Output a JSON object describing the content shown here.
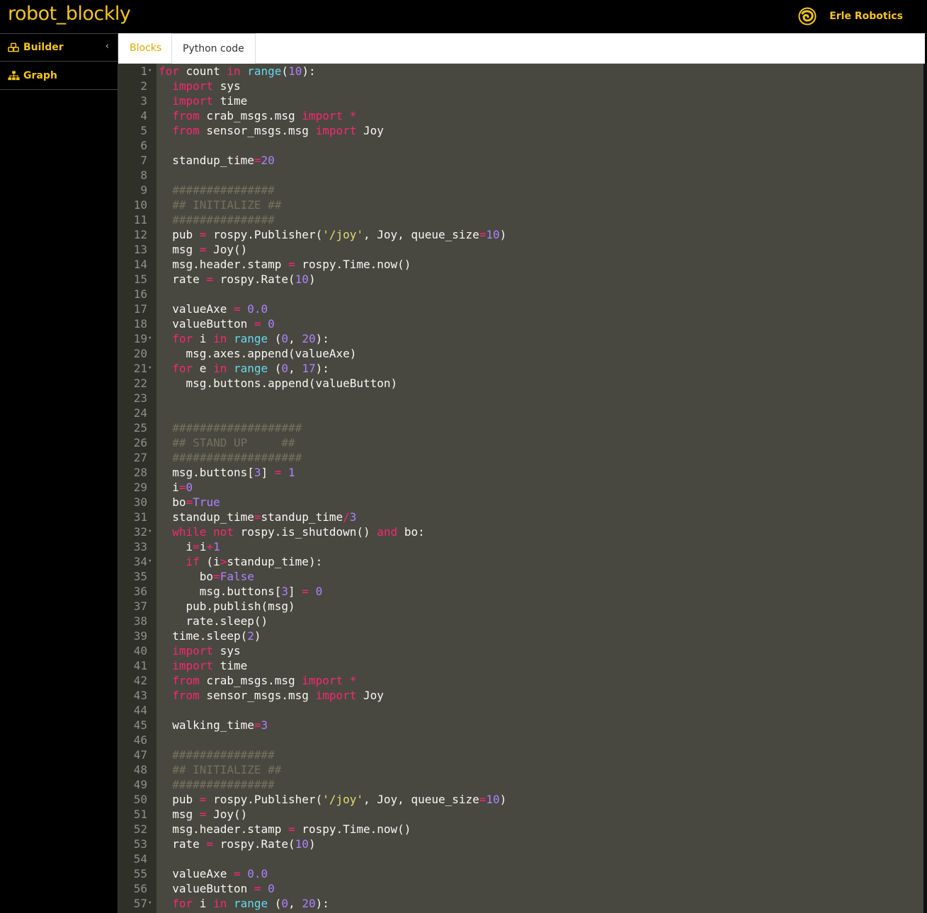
{
  "app": {
    "title": "robot_blockly",
    "brand": "Erle Robotics"
  },
  "sidebar": {
    "items": [
      {
        "label": "Builder",
        "icon": "cubes-icon",
        "collapse": "‹"
      },
      {
        "label": "Graph",
        "icon": "sitemap-icon"
      }
    ]
  },
  "tabs": [
    {
      "label": "Blocks",
      "active": false
    },
    {
      "label": "Python code",
      "active": true
    }
  ],
  "colors": {
    "accent": "#f5c518",
    "editor_bg": "#484840",
    "gutter_bg": "#2f3129",
    "keyword": "#f92672",
    "builtin": "#66d9ef",
    "number": "#ae81ff",
    "string": "#e6db74",
    "comment": "#75715e"
  },
  "code": {
    "folded_lines": [
      1,
      19,
      21,
      32,
      34,
      57
    ],
    "lines": [
      "for count in range(10):",
      "  import sys",
      "  import time",
      "  from crab_msgs.msg import *",
      "  from sensor_msgs.msg import Joy",
      "",
      "  standup_time=20",
      "",
      "  ###############",
      "  ## INITIALIZE ##",
      "  ###############",
      "  pub = rospy.Publisher('/joy', Joy, queue_size=10)",
      "  msg = Joy()",
      "  msg.header.stamp = rospy.Time.now()",
      "  rate = rospy.Rate(10)",
      "",
      "  valueAxe = 0.0",
      "  valueButton = 0",
      "  for i in range (0, 20):",
      "    msg.axes.append(valueAxe)",
      "  for e in range (0, 17):",
      "    msg.buttons.append(valueButton)",
      "",
      "",
      "  ###################",
      "  ## STAND UP     ##",
      "  ###################",
      "  msg.buttons[3] = 1",
      "  i=0",
      "  bo=True",
      "  standup_time=standup_time/3",
      "  while not rospy.is_shutdown() and bo:",
      "    i=i+1",
      "    if (i>standup_time):",
      "      bo=False",
      "      msg.buttons[3] = 0",
      "    pub.publish(msg)",
      "    rate.sleep()",
      "  time.sleep(2)",
      "  import sys",
      "  import time",
      "  from crab_msgs.msg import *",
      "  from sensor_msgs.msg import Joy",
      "",
      "  walking_time=3",
      "",
      "  ###############",
      "  ## INITIALIZE ##",
      "  ###############",
      "  pub = rospy.Publisher('/joy', Joy, queue_size=10)",
      "  msg = Joy()",
      "  msg.header.stamp = rospy.Time.now()",
      "  rate = rospy.Rate(10)",
      "",
      "  valueAxe = 0.0",
      "  valueButton = 0",
      "  for i in range (0, 20):"
    ]
  }
}
